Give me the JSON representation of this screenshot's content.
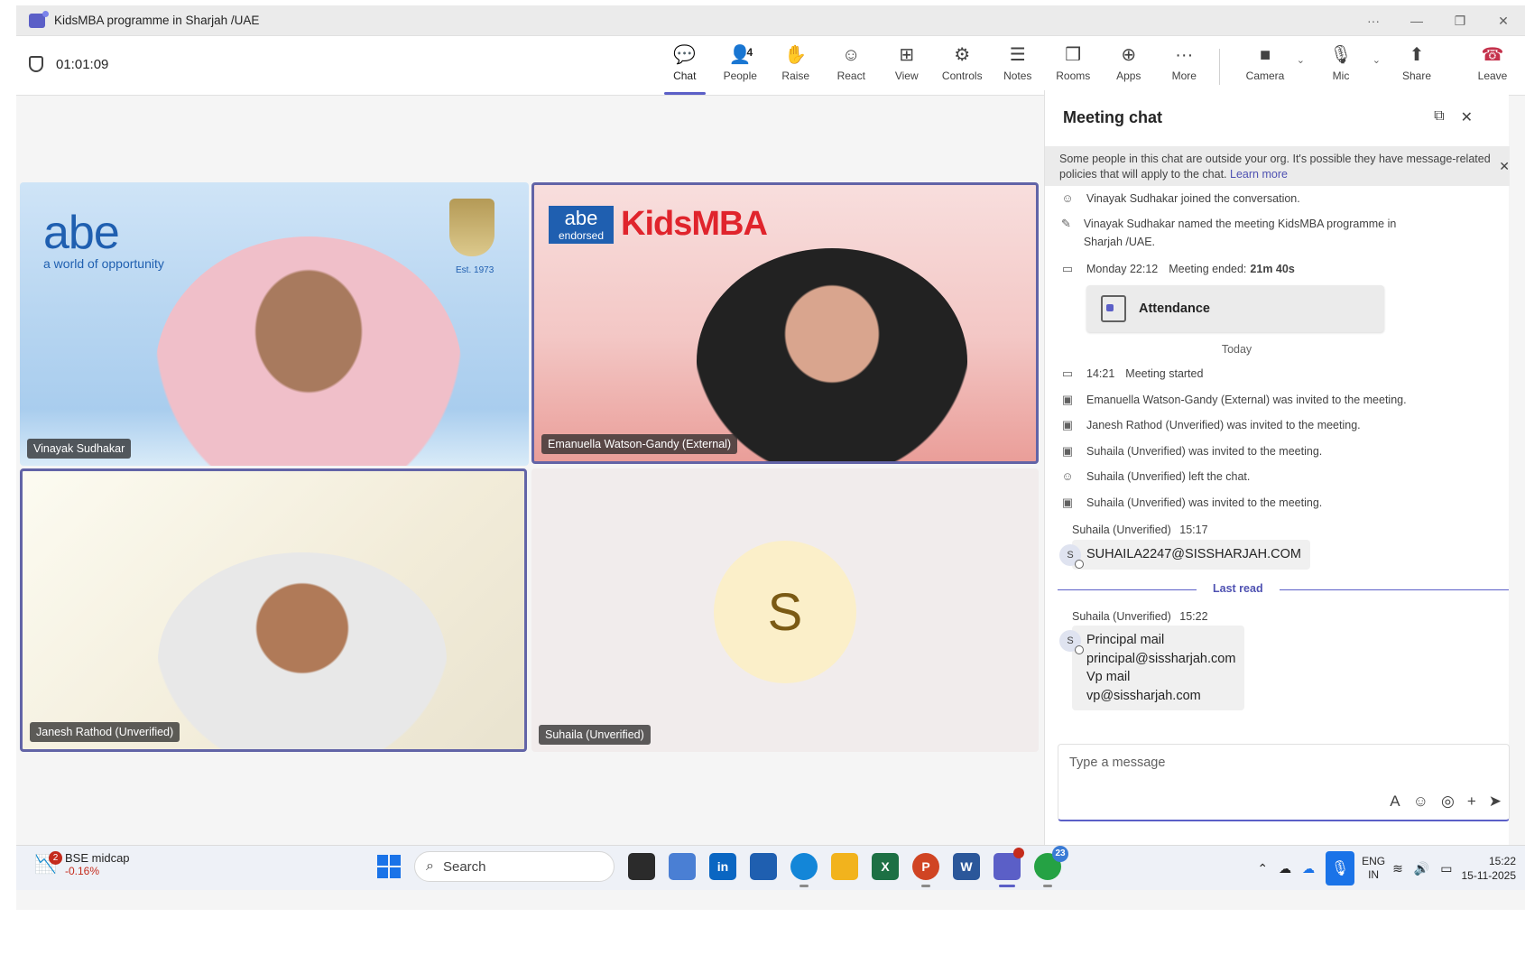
{
  "window": {
    "title": "KidsMBA programme in Sharjah /UAE",
    "controls": [
      "···",
      "—",
      "❐",
      "✕"
    ]
  },
  "toolbar": {
    "timer": "01:01:09",
    "tools": [
      {
        "label": "Chat",
        "icon": "chat-icon",
        "glyph": "💬",
        "active": true
      },
      {
        "label": "People",
        "icon": "people-icon",
        "glyph": "👤",
        "badge": "4"
      },
      {
        "label": "Raise",
        "icon": "raise-hand-icon",
        "glyph": "✋"
      },
      {
        "label": "React",
        "icon": "react-icon",
        "glyph": "☺"
      },
      {
        "label": "View",
        "icon": "view-grid-icon",
        "glyph": "⊞"
      },
      {
        "label": "Controls",
        "icon": "controls-icon",
        "glyph": "⚙"
      },
      {
        "label": "Notes",
        "icon": "notes-icon",
        "glyph": "☰"
      },
      {
        "label": "Rooms",
        "icon": "rooms-icon",
        "glyph": "❒"
      },
      {
        "label": "Apps",
        "icon": "apps-icon",
        "glyph": "⊕"
      },
      {
        "label": "More",
        "icon": "more-icon",
        "glyph": "···"
      }
    ],
    "camera_label": "Camera",
    "mic_label": "Mic",
    "share_label": "Share",
    "leave_label": "Leave"
  },
  "video": {
    "tiles": [
      {
        "name": "Vinayak Sudhakar",
        "speaking": false
      },
      {
        "name": "Emanuella Watson-Gandy (External)",
        "speaking": true
      },
      {
        "name": "Janesh Rathod (Unverified)",
        "speaking": true
      },
      {
        "name": "Suhaila (Unverified)",
        "speaking": false,
        "initial": "S"
      }
    ],
    "abe_word": "abe",
    "abe_tagline": "a world of opportunity",
    "crest_est": "Est. 1973",
    "kids_box_top": "abe",
    "kids_box_bottom": "endorsed",
    "kids_k": "KidsMBA"
  },
  "chat": {
    "title": "Meeting chat",
    "notice_text": "Some people in this chat are outside your org. It's possible they have message-related policies that will apply to the chat.",
    "notice_link": "Learn more",
    "events_before": [
      {
        "icon": "person-add-icon",
        "text": "Vinayak Sudhakar joined the conversation."
      },
      {
        "icon": "pencil-icon",
        "text": "Vinayak Sudhakar named the meeting KidsMBA programme in Sharjah /UAE."
      }
    ],
    "meeting_ended": {
      "time": "Monday 22:12",
      "text": "Meeting ended:",
      "duration": "21m 40s"
    },
    "attendance_label": "Attendance",
    "day_divider": "Today",
    "meeting_started": {
      "time": "14:21",
      "text": "Meeting started"
    },
    "events_after": [
      {
        "icon": "calendar-add-icon",
        "text": "Emanuella Watson-Gandy (External) was invited to the meeting."
      },
      {
        "icon": "calendar-add-icon",
        "text": "Janesh Rathod (Unverified) was invited to the meeting."
      },
      {
        "icon": "calendar-add-icon",
        "text": "Suhaila (Unverified) was invited to the meeting."
      },
      {
        "icon": "person-leave-icon",
        "text": "Suhaila (Unverified) left the chat."
      },
      {
        "icon": "calendar-add-icon",
        "text": "Suhaila (Unverified) was invited to the meeting."
      }
    ],
    "msg1": {
      "sender": "Suhaila (Unverified)",
      "time": "15:17",
      "avatar": "S",
      "lines": [
        "SUHAILA2247@SISSHARJAH.COM"
      ]
    },
    "last_read": "Last read",
    "msg2": {
      "sender": "Suhaila (Unverified)",
      "time": "15:22",
      "avatar": "S",
      "lines": [
        "Principal mail",
        "principal@sissharjah.com",
        "Vp mail",
        "vp@sissharjah.com"
      ]
    },
    "compose_placeholder": "Type a message"
  },
  "taskbar": {
    "stock_name": "BSE midcap",
    "stock_change": "-0.16%",
    "stock_badge": "2",
    "search_label": "Search",
    "whatsapp_badge": "23",
    "lang_line1": "ENG",
    "lang_line2": "IN",
    "time": "15:22",
    "date": "15-11-2025"
  }
}
